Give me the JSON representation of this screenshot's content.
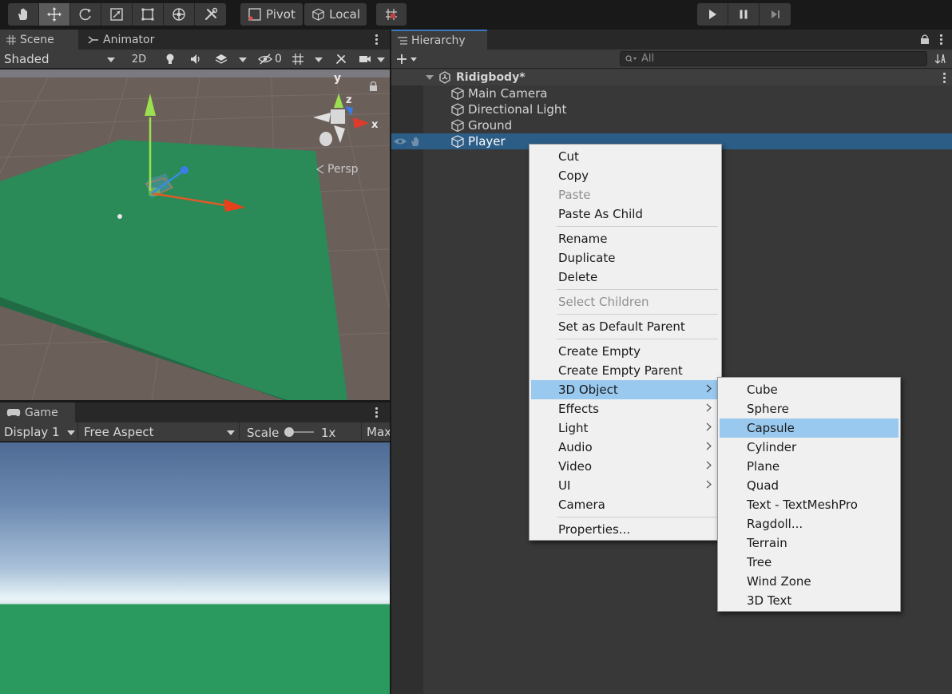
{
  "toolbar": {
    "pivot_label": "Pivot",
    "local_label": "Local"
  },
  "scene_panel": {
    "tabs": [
      {
        "label": "Scene",
        "icon": "grid-icon"
      },
      {
        "label": "Animator",
        "icon": "animator-icon"
      }
    ],
    "draw_mode": "Shaded",
    "mode_2d": "2D",
    "hidden_count": "0",
    "gizmo_axes": {
      "y": "y",
      "z": "z",
      "x": "x"
    },
    "projection": "Persp"
  },
  "game_panel": {
    "tab_label": "Game",
    "display": "Display 1",
    "aspect": "Free Aspect",
    "scale_label": "Scale",
    "scale_value": "1x",
    "maximize": "Max"
  },
  "hierarchy": {
    "tab_label": "Hierarchy",
    "search_placeholder": "All",
    "scene_name": "Ridigbody*",
    "items": [
      {
        "label": "Main Camera"
      },
      {
        "label": "Directional Light"
      },
      {
        "label": "Ground"
      },
      {
        "label": "Player",
        "selected": true
      }
    ]
  },
  "context_menu": {
    "items": [
      {
        "label": "Cut"
      },
      {
        "label": "Copy"
      },
      {
        "label": "Paste",
        "disabled": true
      },
      {
        "label": "Paste As Child"
      },
      {
        "label": "Rename"
      },
      {
        "label": "Duplicate"
      },
      {
        "label": "Delete"
      },
      {
        "label": "Select Children",
        "disabled": true
      },
      {
        "label": "Set as Default Parent"
      },
      {
        "label": "Create Empty"
      },
      {
        "label": "Create Empty Parent"
      },
      {
        "label": "3D Object",
        "submenu": true,
        "highlighted": true
      },
      {
        "label": "Effects",
        "submenu": true
      },
      {
        "label": "Light",
        "submenu": true
      },
      {
        "label": "Audio",
        "submenu": true
      },
      {
        "label": "Video",
        "submenu": true
      },
      {
        "label": "UI",
        "submenu": true
      },
      {
        "label": "Camera"
      },
      {
        "label": "Properties..."
      }
    ]
  },
  "submenu_3d": {
    "items": [
      {
        "label": "Cube"
      },
      {
        "label": "Sphere"
      },
      {
        "label": "Capsule",
        "highlighted": true
      },
      {
        "label": "Cylinder"
      },
      {
        "label": "Plane"
      },
      {
        "label": "Quad"
      },
      {
        "label": "Text - TextMeshPro"
      },
      {
        "label": "Ragdoll..."
      },
      {
        "label": "Terrain"
      },
      {
        "label": "Tree"
      },
      {
        "label": "Wind Zone"
      },
      {
        "label": "3D Text"
      }
    ]
  },
  "colors": {
    "accent_selection": "#2c5d87",
    "menu_highlight": "#99c9ef",
    "ground_green": "#2a8a58"
  }
}
